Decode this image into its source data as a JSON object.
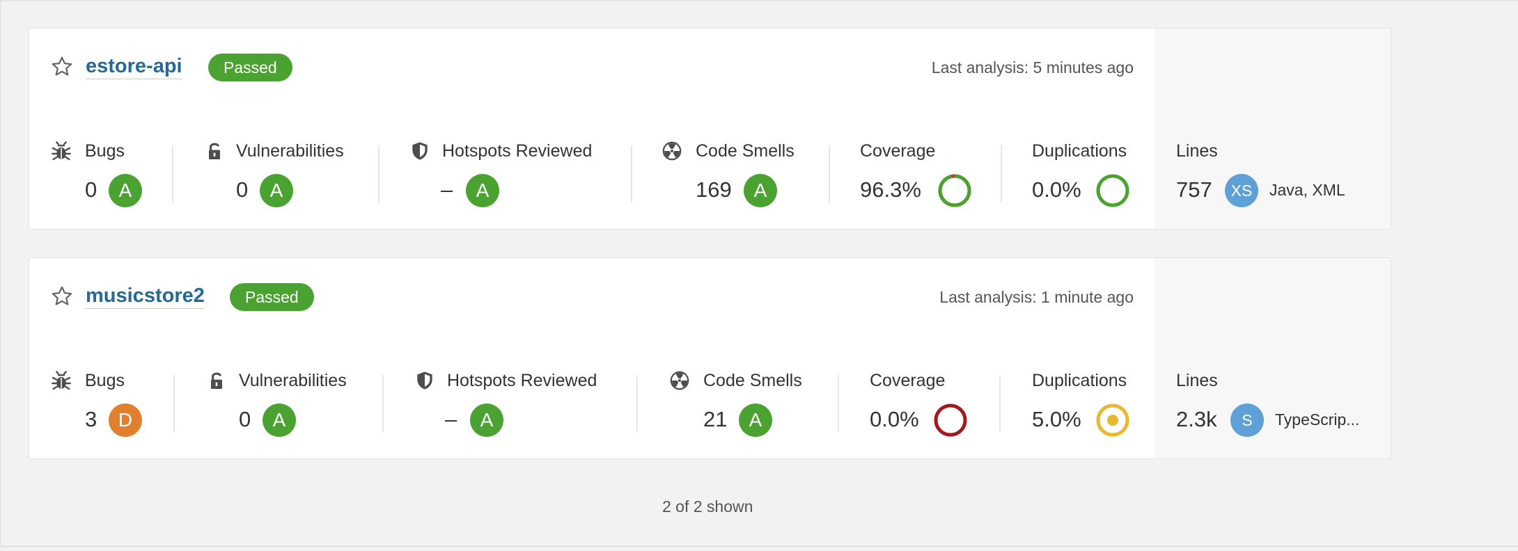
{
  "projects": [
    {
      "name": "estore-api",
      "quality_gate": "Passed",
      "last_analysis": "Last analysis: 5 minutes ago",
      "bugs": {
        "label": "Bugs",
        "value": "0",
        "rating": "A",
        "rating_color": "#4aa230"
      },
      "vulnerabilities": {
        "label": "Vulnerabilities",
        "value": "0",
        "rating": "A",
        "rating_color": "#4aa230"
      },
      "hotspots": {
        "label": "Hotspots Reviewed",
        "value": "–",
        "rating": "A",
        "rating_color": "#4aa230"
      },
      "code_smells": {
        "label": "Code Smells",
        "value": "169",
        "rating": "A",
        "rating_color": "#4aa230"
      },
      "coverage": {
        "label": "Coverage",
        "value": "96.3%",
        "percent": 96.3,
        "color": "#4aa230"
      },
      "duplications": {
        "label": "Duplications",
        "value": "0.0%",
        "percent": 0.0,
        "color": "#4aa230"
      },
      "lines": {
        "label": "Lines",
        "value": "757",
        "size": "XS",
        "languages": "Java, XML"
      }
    },
    {
      "name": "musicstore2",
      "quality_gate": "Passed",
      "last_analysis": "Last analysis: 1 minute ago",
      "bugs": {
        "label": "Bugs",
        "value": "3",
        "rating": "D",
        "rating_color": "#e07f2e"
      },
      "vulnerabilities": {
        "label": "Vulnerabilities",
        "value": "0",
        "rating": "A",
        "rating_color": "#4aa230"
      },
      "hotspots": {
        "label": "Hotspots Reviewed",
        "value": "–",
        "rating": "A",
        "rating_color": "#4aa230"
      },
      "code_smells": {
        "label": "Code Smells",
        "value": "21",
        "rating": "A",
        "rating_color": "#4aa230"
      },
      "coverage": {
        "label": "Coverage",
        "value": "0.0%",
        "percent": 0.0,
        "color": "#a4191d"
      },
      "duplications": {
        "label": "Duplications",
        "value": "5.0%",
        "percent": 5.0,
        "color": "#e8b92e"
      },
      "lines": {
        "label": "Lines",
        "value": "2.3k",
        "size": "S",
        "languages": "TypeScrip..."
      }
    }
  ],
  "footer": {
    "shown": "2 of 2 shown"
  },
  "icons": {
    "favorite": "star-icon",
    "bugs": "bug-icon",
    "vulnerabilities": "lock-icon",
    "hotspots": "shield-icon",
    "code_smells": "radiation-icon"
  },
  "colors": {
    "passed": "#4aa230",
    "link": "#236a97",
    "rating_a": "#4aa230",
    "rating_d": "#e07f2e",
    "size_badge": "#5fa1d6"
  }
}
